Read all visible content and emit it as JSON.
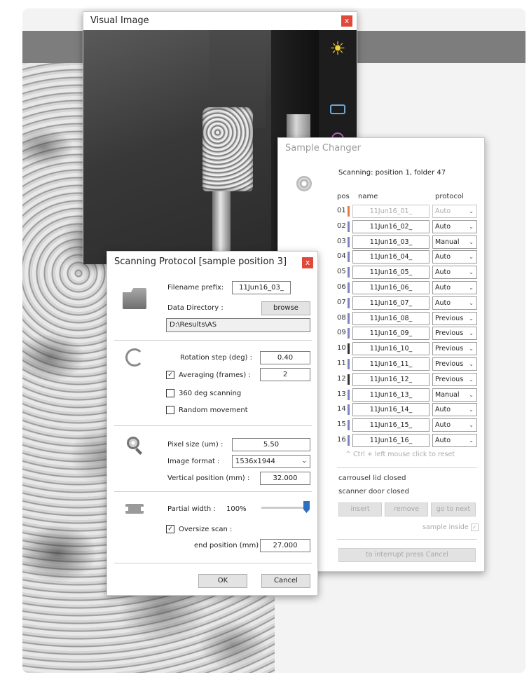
{
  "visual_window": {
    "title": "Visual Image",
    "close_label": "x"
  },
  "changer": {
    "title": "Sample Changer",
    "status": "Scanning: position 1, folder 47",
    "col_pos": "pos",
    "col_name": "name",
    "col_protocol": "protocol",
    "rows": [
      {
        "pos": "01",
        "name": "11Jun16_01_",
        "protocol": "Auto",
        "mark_color": "#e57b4a"
      },
      {
        "pos": "02",
        "name": "11Jun16_02_",
        "protocol": "Auto",
        "mark_color": "#7c86c4"
      },
      {
        "pos": "03",
        "name": "11Jun16_03_",
        "protocol": "Manual",
        "mark_color": "#7c86c4"
      },
      {
        "pos": "04",
        "name": "11Jun16_04_",
        "protocol": "Auto",
        "mark_color": "#7c86c4"
      },
      {
        "pos": "05",
        "name": "11Jun16_05_",
        "protocol": "Auto",
        "mark_color": "#7c86c4"
      },
      {
        "pos": "06",
        "name": "11Jun16_06_",
        "protocol": "Auto",
        "mark_color": "#7c86c4"
      },
      {
        "pos": "07",
        "name": "11Jun16_07_",
        "protocol": "Auto",
        "mark_color": "#7c86c4"
      },
      {
        "pos": "08",
        "name": "11Jun16_08_",
        "protocol": "Previous",
        "mark_color": "#7c86c4"
      },
      {
        "pos": "09",
        "name": "11Jun16_09_",
        "protocol": "Previous",
        "mark_color": "#7c86c4"
      },
      {
        "pos": "10",
        "name": "11Jun16_10_",
        "protocol": "Previous",
        "mark_color": "#333333"
      },
      {
        "pos": "11",
        "name": "11Jun16_11_",
        "protocol": "Previous",
        "mark_color": "#7c86c4"
      },
      {
        "pos": "12",
        "name": "11Jun16_12_",
        "protocol": "Previous",
        "mark_color": "#333333"
      },
      {
        "pos": "13",
        "name": "11Jun16_13_",
        "protocol": "Manual",
        "mark_color": "#7c86c4"
      },
      {
        "pos": "14",
        "name": "11Jun16_14_",
        "protocol": "Auto",
        "mark_color": "#7c86c4"
      },
      {
        "pos": "15",
        "name": "11Jun16_15_",
        "protocol": "Auto",
        "mark_color": "#7c86c4"
      },
      {
        "pos": "16",
        "name": "11Jun16_16_",
        "protocol": "Auto",
        "mark_color": "#7c86c4"
      }
    ],
    "hint": "^ Ctrl + left mouse click to reset",
    "lid_status": "carrousel lid closed",
    "door_status": "scanner door closed",
    "insert_label": "insert",
    "remove_label": "remove",
    "goto_next_label": "go to next",
    "sample_inside_label": "sample inside",
    "interrupt_label": "to interrupt press Cancel"
  },
  "protocol": {
    "title": "Scanning Protocol [sample position 3]",
    "filename_prefix_label": "Filename prefix:",
    "filename_prefix_value": "11Jun16_03_",
    "data_dir_label": "Data Directory :",
    "browse_label": "browse",
    "data_dir_value": "D:\\Results\\AS",
    "rotation_step_label": "Rotation step (deg) :",
    "rotation_step_value": "0.40",
    "averaging_label": "Averaging (frames) :",
    "averaging_value": "2",
    "averaging_checked": true,
    "scan360_label": "360 deg scanning",
    "random_movement_label": "Random movement",
    "pixel_size_label": "Pixel size (um) :",
    "pixel_size_value": "5.50",
    "image_format_label": "Image format :",
    "image_format_value": "1536x1944",
    "vertical_position_label": "Vertical position (mm) :",
    "vertical_position_value": "32.000",
    "partial_width_label": "Partial width :",
    "partial_width_value": "100%",
    "partial_width_fraction": 1.0,
    "oversize_label": "Oversize scan :",
    "oversize_checked": true,
    "end_position_label": "end position (mm) :",
    "end_position_value": "27.000",
    "ok_label": "OK",
    "cancel_label": "Cancel"
  },
  "colors": {
    "close_button": "#e0493a",
    "slider_thumb": "#2f6fc0",
    "sun_icon": "#f6d02f"
  }
}
